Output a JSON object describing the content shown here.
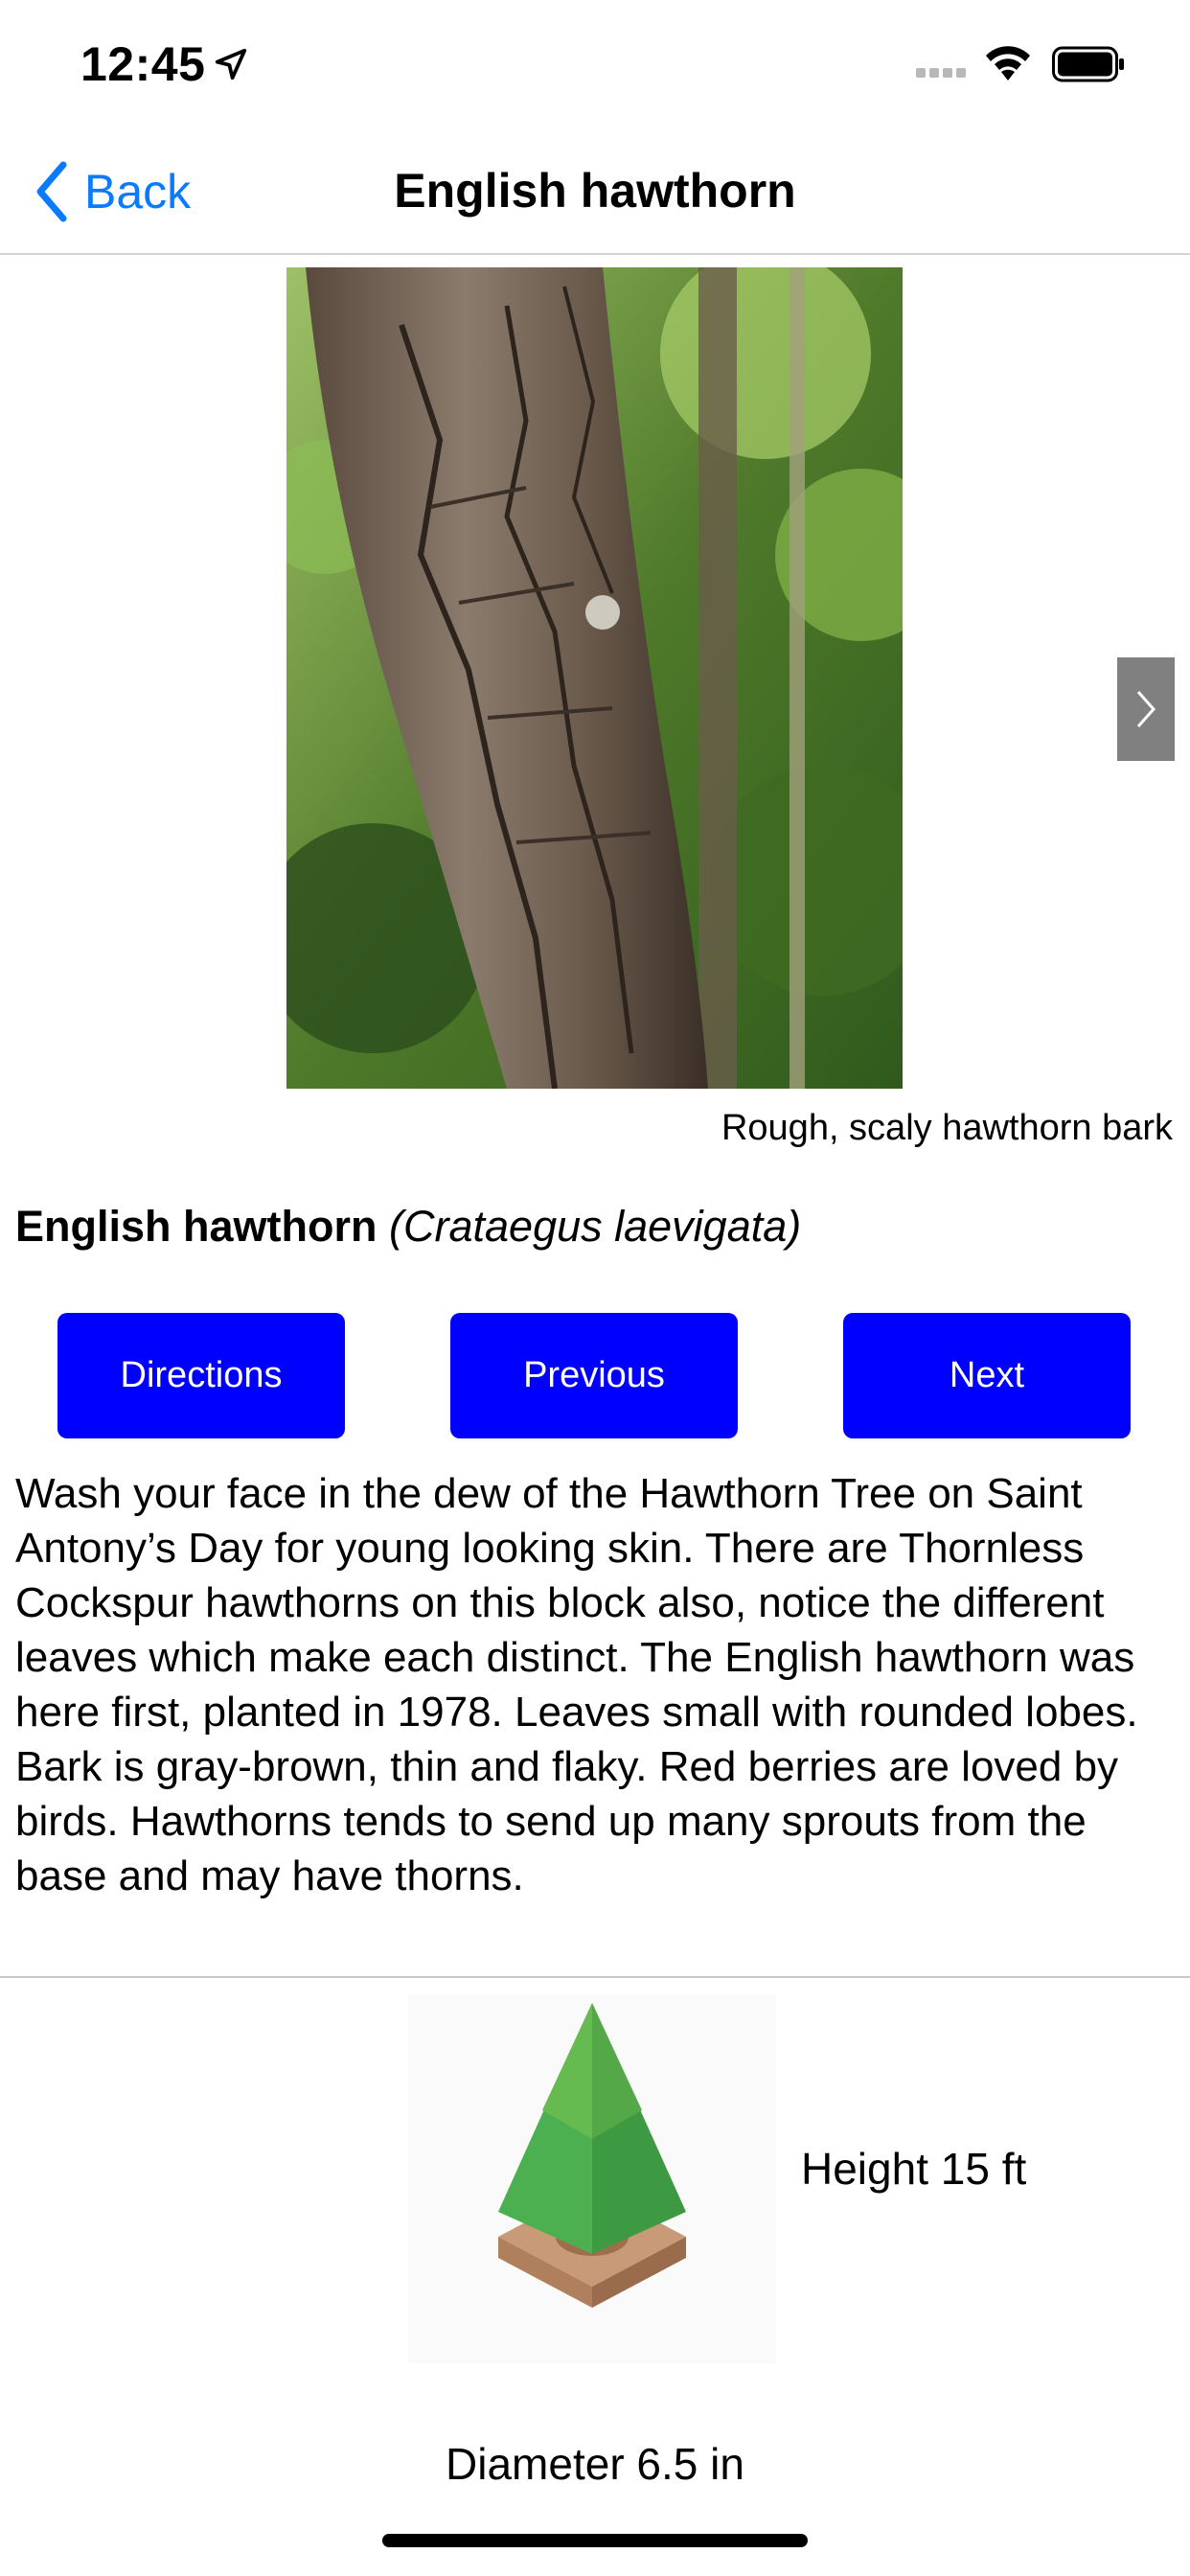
{
  "status_bar": {
    "time": "12:45"
  },
  "nav": {
    "back_label": "Back",
    "title": "English hawthorn"
  },
  "photo": {
    "caption": "Rough, scaly hawthorn bark"
  },
  "species": {
    "common_name": "English hawthorn",
    "scientific_name": "(Crataegus laevigata)"
  },
  "buttons": {
    "directions": "Directions",
    "previous": "Previous",
    "next": "Next"
  },
  "description": "Wash your face in the dew of the Hawthorn Tree on Saint Antony’s Day for young looking skin. There are Thornless Cockspur hawthorns on this block also, notice the different leaves which make each distinct. The English hawthorn was here first, planted in 1978. Leaves small with rounded lobes. Bark is gray-brown, thin and flaky. Red berries are loved by birds. Hawthorns tends to send up many sprouts from the base and may have thorns.",
  "stats": {
    "height": "Height 15 ft",
    "diameter": "Diameter 6.5 in"
  },
  "colors": {
    "accent": "#0a7aff",
    "button": "#0000ff"
  }
}
